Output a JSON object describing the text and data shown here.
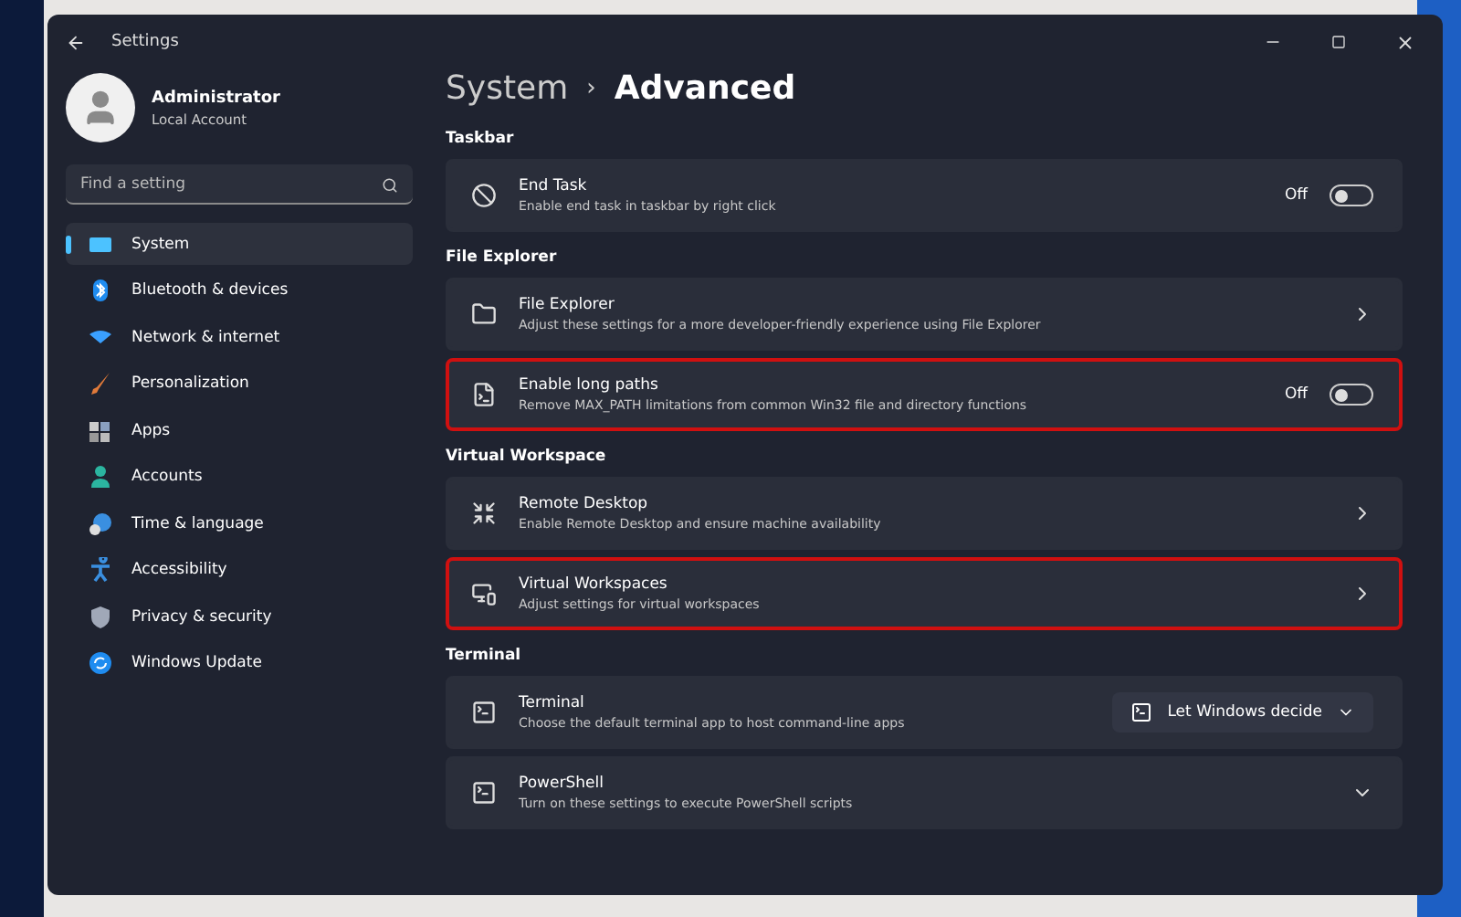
{
  "window": {
    "title": "Settings"
  },
  "account": {
    "name": "Administrator",
    "type": "Local Account"
  },
  "search": {
    "placeholder": "Find a setting"
  },
  "nav": [
    {
      "label": "System",
      "selected": true
    },
    {
      "label": "Bluetooth & devices",
      "selected": false
    },
    {
      "label": "Network & internet",
      "selected": false
    },
    {
      "label": "Personalization",
      "selected": false
    },
    {
      "label": "Apps",
      "selected": false
    },
    {
      "label": "Accounts",
      "selected": false
    },
    {
      "label": "Time & language",
      "selected": false
    },
    {
      "label": "Accessibility",
      "selected": false
    },
    {
      "label": "Privacy & security",
      "selected": false
    },
    {
      "label": "Windows Update",
      "selected": false
    }
  ],
  "breadcrumb": {
    "parent": "System",
    "separator": "›",
    "current": "Advanced"
  },
  "sections": [
    {
      "title": "Taskbar",
      "rows": [
        {
          "kind": "toggle",
          "title": "End Task",
          "description": "Enable end task in taskbar by right click",
          "on": false,
          "state_label": "Off",
          "highlighted": false
        }
      ]
    },
    {
      "title": "File Explorer",
      "rows": [
        {
          "kind": "link",
          "title": "File Explorer",
          "description": "Adjust these settings for a more developer-friendly experience using File Explorer",
          "highlighted": false
        },
        {
          "kind": "toggle",
          "title": "Enable long paths",
          "description": "Remove MAX_PATH limitations from common Win32 file and directory functions",
          "on": false,
          "state_label": "Off",
          "highlighted": true
        }
      ]
    },
    {
      "title": "Virtual Workspace",
      "rows": [
        {
          "kind": "link",
          "title": "Remote Desktop",
          "description": "Enable Remote Desktop and ensure machine availability",
          "highlighted": false
        },
        {
          "kind": "link",
          "title": "Virtual Workspaces",
          "description": "Adjust settings for virtual workspaces",
          "highlighted": true
        }
      ]
    },
    {
      "title": "Terminal",
      "rows": [
        {
          "kind": "dropdown",
          "title": "Terminal",
          "description": "Choose the default terminal app to host command-line apps",
          "value": "Let Windows decide",
          "highlighted": false
        },
        {
          "kind": "expand",
          "title": "PowerShell",
          "description": "Turn on these settings to execute PowerShell scripts",
          "highlighted": false
        }
      ]
    }
  ]
}
